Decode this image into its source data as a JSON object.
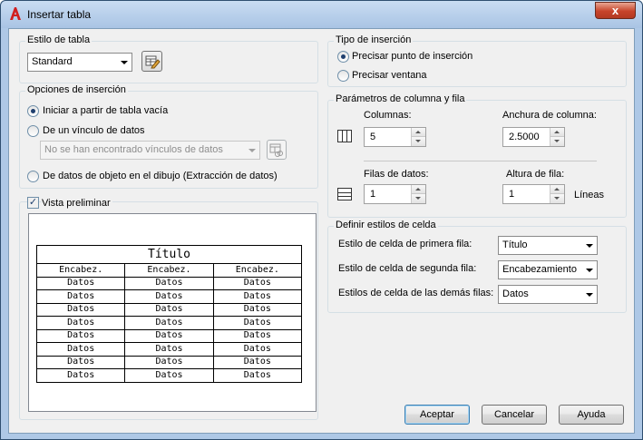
{
  "window": {
    "title": "Insertar tabla",
    "close_glyph": "x"
  },
  "estilo": {
    "group_title": "Estilo de tabla",
    "combo_value": "Standard",
    "edit_icon": "table-style-edit-icon"
  },
  "opciones": {
    "group_title": "Opciones de inserción",
    "radios": [
      {
        "label": "Iniciar a partir de tabla vacía",
        "checked": true
      },
      {
        "label": "De un vínculo de datos",
        "checked": false
      },
      {
        "label": "De datos de objeto en el dibujo (Extracción de datos)",
        "checked": false
      }
    ],
    "link_combo": "No se han encontrado vínculos de datos",
    "link_icon": "data-link-manager-icon"
  },
  "vista": {
    "checkbox_label": "Vista preliminar",
    "checked": true,
    "table": {
      "title": "Título",
      "headers": [
        "Encabez.",
        "Encabez.",
        "Encabez."
      ],
      "rows": [
        [
          "Datos",
          "Datos",
          "Datos"
        ],
        [
          "Datos",
          "Datos",
          "Datos"
        ],
        [
          "Datos",
          "Datos",
          "Datos"
        ],
        [
          "Datos",
          "Datos",
          "Datos"
        ],
        [
          "Datos",
          "Datos",
          "Datos"
        ],
        [
          "Datos",
          "Datos",
          "Datos"
        ],
        [
          "Datos",
          "Datos",
          "Datos"
        ],
        [
          "Datos",
          "Datos",
          "Datos"
        ]
      ]
    }
  },
  "tipo": {
    "group_title": "Tipo de inserción",
    "radios": [
      {
        "label": "Precisar punto de inserción",
        "checked": true
      },
      {
        "label": "Precisar ventana",
        "checked": false
      }
    ]
  },
  "parametros": {
    "group_title": "Parámetros de columna y fila",
    "columnas_label": "Columnas:",
    "columnas_value": "5",
    "anchura_label": "Anchura de columna:",
    "anchura_value": "2.5000",
    "filas_label": "Filas de datos:",
    "filas_value": "1",
    "altura_label": "Altura de fila:",
    "altura_value": "1",
    "lineas_label": "Líneas",
    "columns_icon": "columns-icon",
    "rows_icon": "rows-icon"
  },
  "celdas": {
    "group_title": "Definir estilos de celda",
    "items": [
      {
        "label": "Estilo de celda de primera fila:",
        "value": "Título"
      },
      {
        "label": "Estilo de celda de segunda fila:",
        "value": "Encabezamiento"
      },
      {
        "label": "Estilos de celda de las demás filas:",
        "value": "Datos"
      }
    ]
  },
  "buttons": {
    "accept": "Aceptar",
    "cancel": "Cancelar",
    "help": "Ayuda"
  }
}
